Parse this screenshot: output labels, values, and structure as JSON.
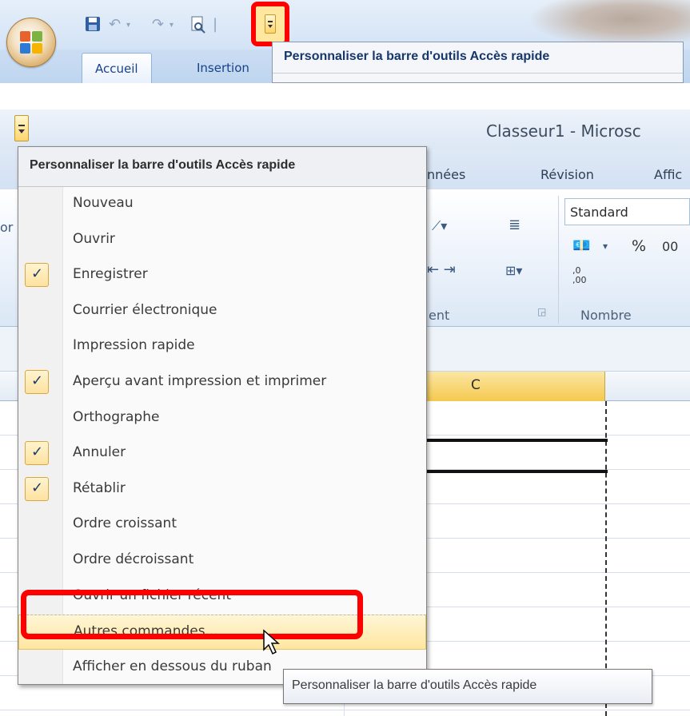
{
  "top": {
    "tabs": [
      "Accueil",
      "Insertion"
    ],
    "menu_header": "Personnaliser la barre d'outils Accès rapide"
  },
  "window": {
    "title": "Classeur1 - Microsc",
    "tabs": [
      "nnées",
      "Révision",
      "Affic"
    ],
    "number_format": "Standard",
    "group_labels": [
      "ent",
      "Nombre"
    ],
    "column_header": "C",
    "ribbon_glyphs": {
      "percent": "%",
      "zero": "00",
      "inc_dec": ",0\n,00"
    },
    "left_partial": "or"
  },
  "menu": {
    "header": "Personnaliser la barre d'outils Accès rapide",
    "items": [
      {
        "label": "Nouveau",
        "checked": false
      },
      {
        "label": "Ouvrir",
        "checked": false
      },
      {
        "label": "Enregistrer",
        "checked": true
      },
      {
        "label": "Courrier électronique",
        "checked": false
      },
      {
        "label": "Impression rapide",
        "checked": false
      },
      {
        "label": "Aperçu avant impression et imprimer",
        "checked": true
      },
      {
        "label": "Orthographe",
        "checked": false
      },
      {
        "label": "Annuler",
        "checked": true
      },
      {
        "label": "Rétablir",
        "checked": true
      },
      {
        "label": "Ordre croissant",
        "checked": false
      },
      {
        "label": "Ordre décroissant",
        "checked": false
      },
      {
        "label": "Ouvrir un fichier récent",
        "checked": false
      },
      {
        "label": "Autres commandes...",
        "checked": false,
        "highlighted": true
      },
      {
        "label": "Afficher en dessous du ruban",
        "checked": false
      }
    ]
  },
  "tooltip": "Personnaliser la barre d'outils Accès rapide",
  "colors": {
    "highlight_red": "#ff0000",
    "check_bg": "#fde2a0",
    "hover_bg": "#ffe6a0"
  },
  "check_mark": "✓"
}
